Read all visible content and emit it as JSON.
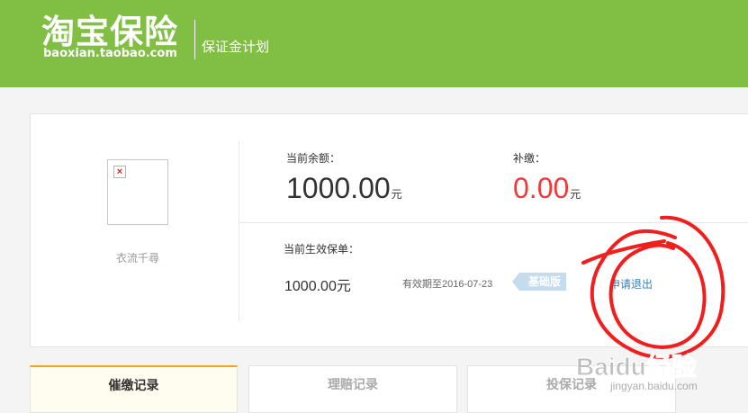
{
  "header": {
    "logo_cn": "淘宝保险",
    "logo_url": "baoxian.taobao.com",
    "subtitle": "保证金计划"
  },
  "shop": {
    "name": "衣流千尋"
  },
  "account": {
    "balance_label": "当前余额：",
    "balance_value": "1000.00",
    "balance_unit": "元",
    "supplement_label": "补缴：",
    "supplement_value": "0.00",
    "supplement_unit": "元"
  },
  "policy": {
    "label": "当前生效保单：",
    "amount": "1000.00元",
    "expiry": "有效期至2016-07-23",
    "badge": "基础版",
    "action": "申请退出"
  },
  "tabs": [
    {
      "label": "催缴记录"
    },
    {
      "label": "理赔记录"
    },
    {
      "label": "投保记录"
    }
  ],
  "watermark": {
    "brand": "Baidu经验",
    "url": "jingyan.baidu.com"
  },
  "colors": {
    "header_bg": "#80bf44",
    "supplement_value": "#f03a3a",
    "link": "#3a7fb5",
    "badge_bg": "#c4dcee",
    "active_tab_border": "#f7a21b",
    "annotation": "#f21e1e"
  },
  "icons": {
    "avatar": "broken-image-icon"
  }
}
